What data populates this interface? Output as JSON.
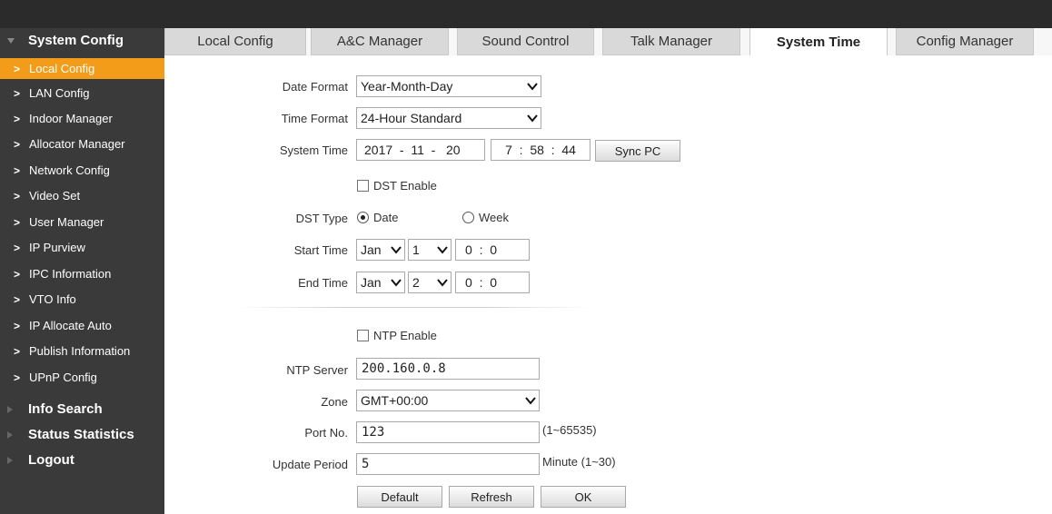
{
  "sidebar": {
    "section_system": "System Config",
    "items": [
      {
        "label": "Local Config"
      },
      {
        "label": "LAN Config"
      },
      {
        "label": "Indoor Manager"
      },
      {
        "label": "Allocator Manager"
      },
      {
        "label": "Network Config"
      },
      {
        "label": "Video Set"
      },
      {
        "label": "User Manager"
      },
      {
        "label": "IP Purview"
      },
      {
        "label": "IPC Information"
      },
      {
        "label": "VTO Info"
      },
      {
        "label": "IP Allocate Auto"
      },
      {
        "label": "Publish Information"
      },
      {
        "label": "UPnP Config"
      }
    ],
    "section_info": "Info Search",
    "section_status": "Status Statistics",
    "section_logout": "Logout",
    "active_color": "#f39c1a"
  },
  "tabs": [
    {
      "label": "Local Config"
    },
    {
      "label": "A&C Manager"
    },
    {
      "label": "Sound Control"
    },
    {
      "label": "Talk Manager"
    },
    {
      "label": "System Time"
    },
    {
      "label": "Config Manager"
    }
  ],
  "form": {
    "date_format_label": "Date Format",
    "date_format_value": "Year-Month-Day",
    "time_format_label": "Time Format",
    "time_format_value": "24-Hour Standard",
    "system_time_label": "System Time",
    "system_date_value": "2017  -  11  -   20",
    "system_clock_value": "7  :  58  :  44",
    "sync_pc_label": "Sync PC",
    "dst_enable_label": "DST Enable",
    "dst_type_label": "DST Type",
    "dst_type_date": "Date",
    "dst_type_week": "Week",
    "start_time_label": "Start Time",
    "start_month": "Jan",
    "start_day": "1",
    "start_clock": "0  :  0",
    "end_time_label": "End Time",
    "end_month": "Jan",
    "end_day": "2",
    "end_clock": "0  :  0",
    "ntp_enable_label": "NTP Enable",
    "ntp_server_label": "NTP Server",
    "ntp_server_value": "200.160.0.8",
    "zone_label": "Zone",
    "zone_value": "GMT+00:00",
    "port_label": "Port No.",
    "port_value": "123",
    "port_hint": "(1~65535)",
    "update_label": "Update Period",
    "update_value": "5",
    "update_hint": "Minute (1~30)",
    "default_btn": "Default",
    "refresh_btn": "Refresh",
    "ok_btn": "OK"
  }
}
